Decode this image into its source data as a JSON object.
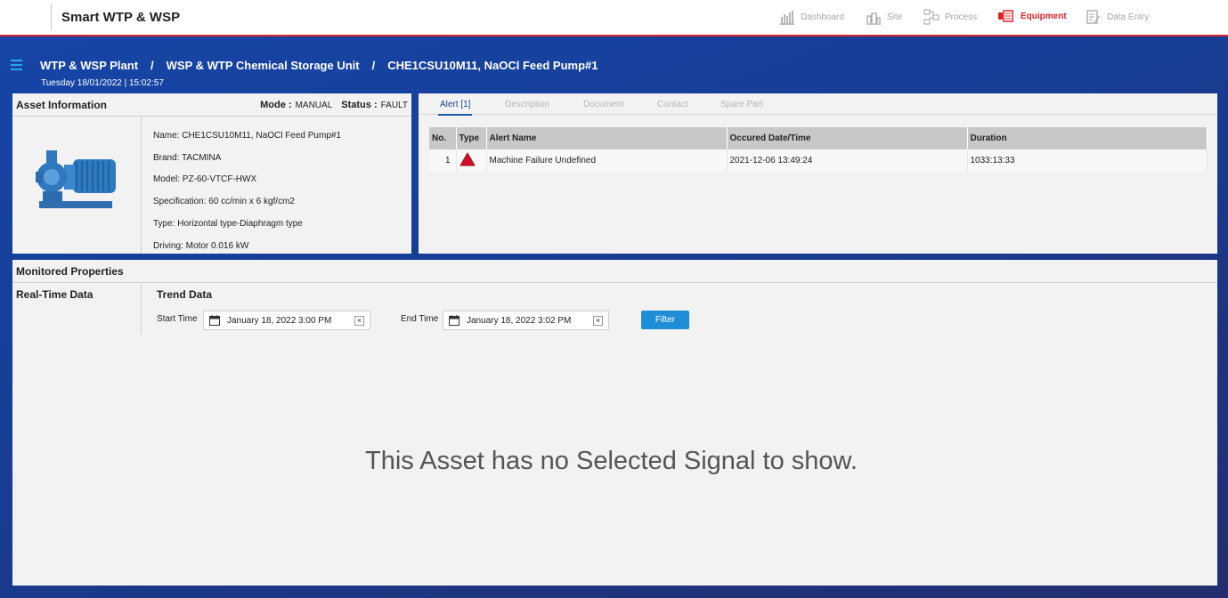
{
  "app": {
    "title": "Smart WTP & WSP"
  },
  "nav": [
    {
      "label": "Dashboard",
      "icon": "dashboard-icon",
      "active": false
    },
    {
      "label": "Site",
      "icon": "site-icon",
      "active": false
    },
    {
      "label": "Process",
      "icon": "process-icon",
      "active": false
    },
    {
      "label": "Equipment",
      "icon": "equipment-icon",
      "active": true
    },
    {
      "label": "Data Entry",
      "icon": "data-entry-icon",
      "active": false
    }
  ],
  "breadcrumb": [
    "WTP & WSP Plant",
    "WSP & WTP Chemical Storage Unit",
    "CHE1CSU10M11, NaOCl Feed Pump#1"
  ],
  "datetime": "Tuesday 18/01/2022 | 15:02:57",
  "asset": {
    "title": "Asset Information",
    "mode_label": "Mode :",
    "mode_value": "MANUAL",
    "status_label": "Status :",
    "status_value": "FAULT",
    "props": [
      "Name: CHE1CSU10M11, NaOCl Feed Pump#1",
      "Brand: TACMINA",
      "Model: PZ-60-VTCF-HWX",
      "Specification: 60 cc/min x 6 kgf/cm2",
      "Type: Horizontal type-Diaphragm type",
      "Driving: Motor 0.016 kW"
    ]
  },
  "tabs": [
    "Alert [1]",
    "Description",
    "Document",
    "Contact",
    "Spare Part"
  ],
  "alert_table": {
    "headers": [
      "No.",
      "Type",
      "Alert Name",
      "Occured Date/Time",
      "Duration"
    ],
    "rows": [
      {
        "no": "1",
        "type_icon": "alert-triangle-icon",
        "name": "Machine Failure Undefined",
        "date": "2021-12-06 13:49:24",
        "duration": "1033:13:33"
      }
    ]
  },
  "monitored": {
    "title": "Monitored Properties",
    "realtime": "Real-Time Data",
    "trend": "Trend Data",
    "start_label": "Start Time",
    "start_value": "January 18, 2022 3:00 PM",
    "end_label": "End Time",
    "end_value": "January 18, 2022 3:02 PM",
    "filter": "Filter",
    "empty_message": "This Asset has no Selected Signal to show.",
    "clear_glyph": "×"
  },
  "colors": {
    "accent_red": "#d9242b",
    "brand_blue": "#1646a8",
    "filter_blue": "#1e8fd6"
  }
}
